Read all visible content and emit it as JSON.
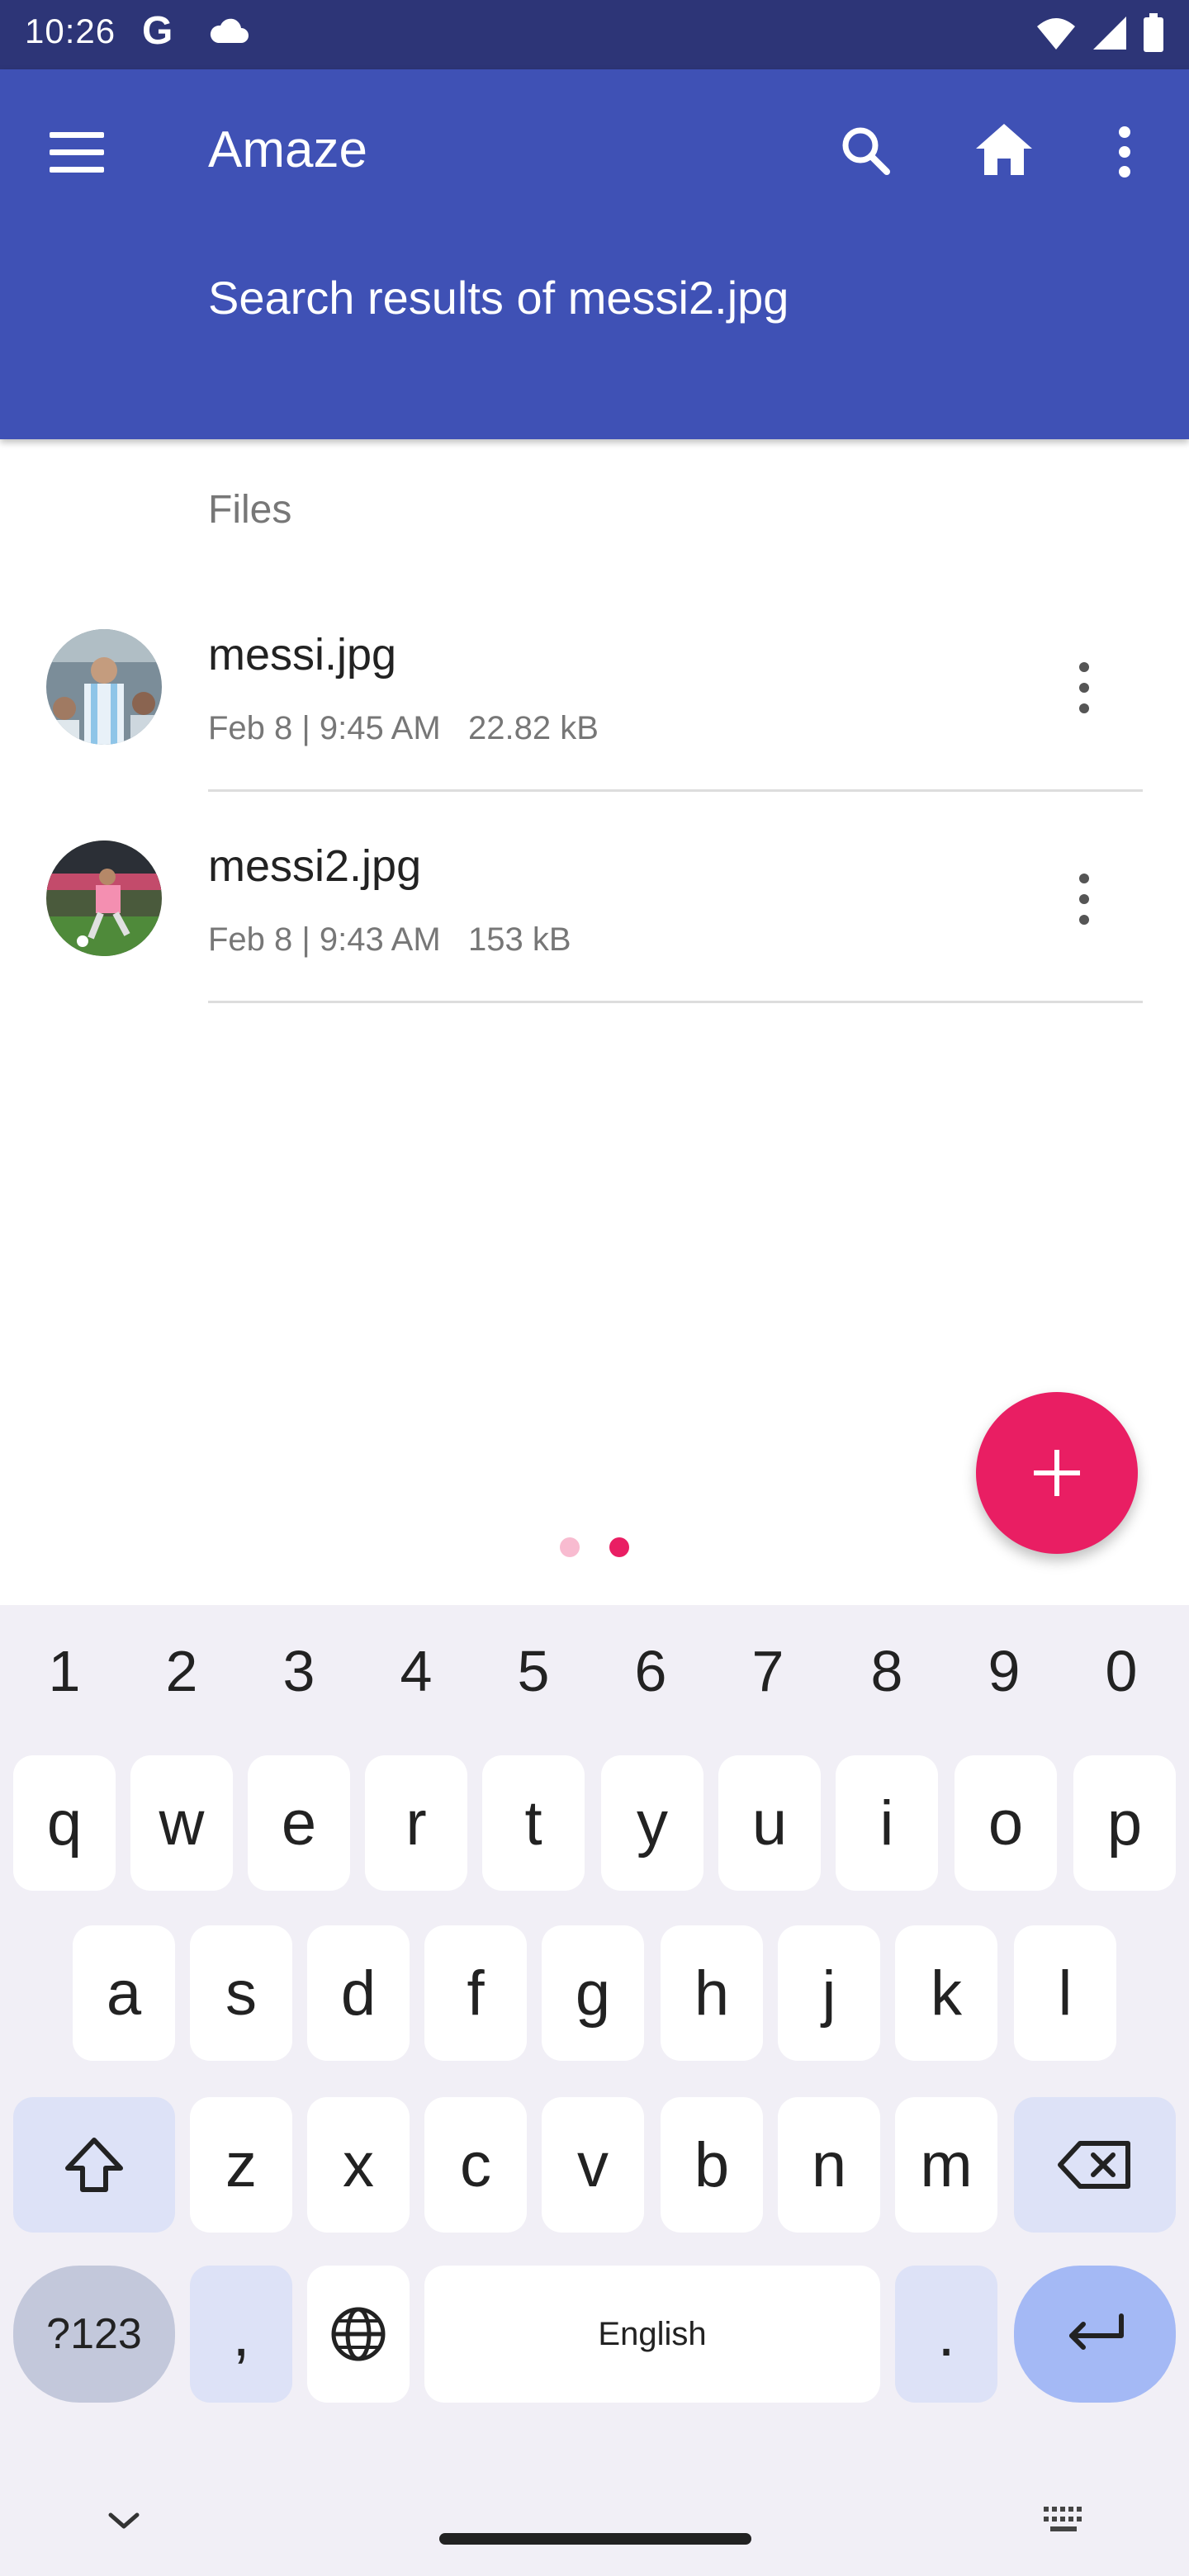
{
  "status": {
    "time": "10:26",
    "g_label": "G"
  },
  "app_bar": {
    "title": "Amaze",
    "subtitle": "Search results of messi2.jpg"
  },
  "section": {
    "title": "Files"
  },
  "files": [
    {
      "name": "messi.jpg",
      "date": "Feb 8 | 9:45 AM",
      "size": "22.82 kB"
    },
    {
      "name": "messi2.jpg",
      "date": "Feb 8 | 9:43 AM",
      "size": "153 kB"
    }
  ],
  "keyboard": {
    "numbers": [
      "1",
      "2",
      "3",
      "4",
      "5",
      "6",
      "7",
      "8",
      "9",
      "0"
    ],
    "row1": [
      "q",
      "w",
      "e",
      "r",
      "t",
      "y",
      "u",
      "i",
      "o",
      "p"
    ],
    "row2": [
      "a",
      "s",
      "d",
      "f",
      "g",
      "h",
      "j",
      "k",
      "l"
    ],
    "row3": [
      "z",
      "x",
      "c",
      "v",
      "b",
      "n",
      "m"
    ],
    "sym_label": "?123",
    "comma": ",",
    "space_label": "English",
    "period": "."
  },
  "colors": {
    "status_bar": "#2d3577",
    "app_bar": "#3f51b5",
    "fab": "#e91e63",
    "accent_key": "#a4b9f5"
  }
}
